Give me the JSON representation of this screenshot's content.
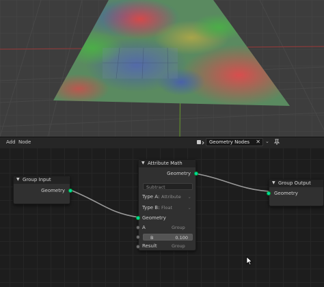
{
  "header": {
    "menu": [
      "Add",
      "Node"
    ],
    "node_tree": "Geometry Nodes"
  },
  "nodes": {
    "group_input": {
      "title": "Group Input",
      "output": "Geometry"
    },
    "attribute_math": {
      "title": "Attribute Math",
      "output": "Geometry",
      "operation": "Subtract",
      "type_a_label": "Type A:",
      "type_a_value": "Attribute",
      "type_b_label": "Type B:",
      "type_b_value": "Float",
      "input_geometry": "Geometry",
      "a_label": "A",
      "a_value": "Group",
      "b_label": "B",
      "b_value": "0.100",
      "result_label": "Result",
      "result_value": "Group"
    },
    "group_output": {
      "title": "Group Output",
      "input": "Geometry"
    }
  },
  "colors": {
    "geometry_socket": "#00d6a3",
    "link": "#9a9a9a",
    "selected_link": "#d04a6a"
  }
}
